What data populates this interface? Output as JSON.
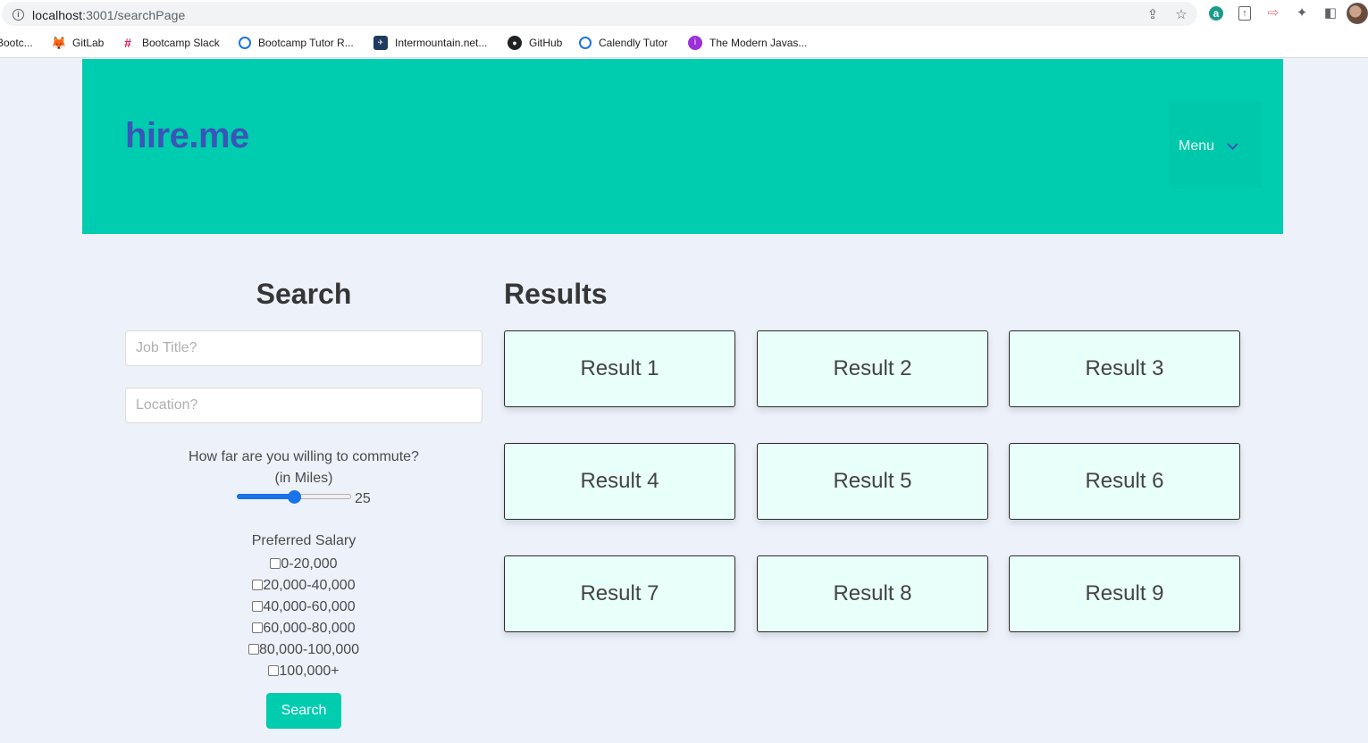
{
  "browser": {
    "url_host": "localhost",
    "url_rest": ":3001/searchPage",
    "bookmarks": [
      {
        "label": "Bootc...",
        "icon": "bookmark-icon",
        "color": "#ffffff"
      },
      {
        "label": "GitLab",
        "icon": "gitlab-icon",
        "color": "#e2432a"
      },
      {
        "label": "Bootcamp Slack",
        "icon": "slack-icon",
        "color": "#4a154b"
      },
      {
        "label": "Bootcamp Tutor R...",
        "icon": "calendly-icon",
        "color": "#1a73e8"
      },
      {
        "label": "Intermountain.net...",
        "icon": "intermountain-icon",
        "color": "#1f3a5f"
      },
      {
        "label": "GitHub",
        "icon": "github-icon",
        "color": "#202124"
      },
      {
        "label": "Calendly Tutor",
        "icon": "calendly-icon",
        "color": "#1a73e8"
      },
      {
        "label": "The Modern Javas...",
        "icon": "javascript-info-icon",
        "color": "#9b30d9"
      }
    ]
  },
  "header": {
    "brand": "hire.me",
    "menu_label": "Menu"
  },
  "search": {
    "heading": "Search",
    "job_title_placeholder": "Job Title?",
    "location_placeholder": "Location?",
    "commute_question": "How far are you willing to commute?",
    "commute_unit": "(in Miles)",
    "commute_value": 25,
    "commute_min": 0,
    "commute_max": 50,
    "commute_value_label": "25",
    "salary_label": "Preferred Salary",
    "salary_options": [
      "0-20,000",
      "20,000-40,000",
      "40,000-60,000",
      "60,000-80,000",
      "80,000-100,000",
      "100,000+"
    ],
    "button_label": "Search"
  },
  "results": {
    "heading": "Results",
    "items": [
      "Result 1",
      "Result 2",
      "Result 3",
      "Result 4",
      "Result 5",
      "Result 6",
      "Result 7",
      "Result 8",
      "Result 9"
    ]
  },
  "colors": {
    "accent": "#00cdaf",
    "brand": "#3a55b8",
    "card_bg": "#e8fffa",
    "page_bg": "#edf2fa"
  }
}
